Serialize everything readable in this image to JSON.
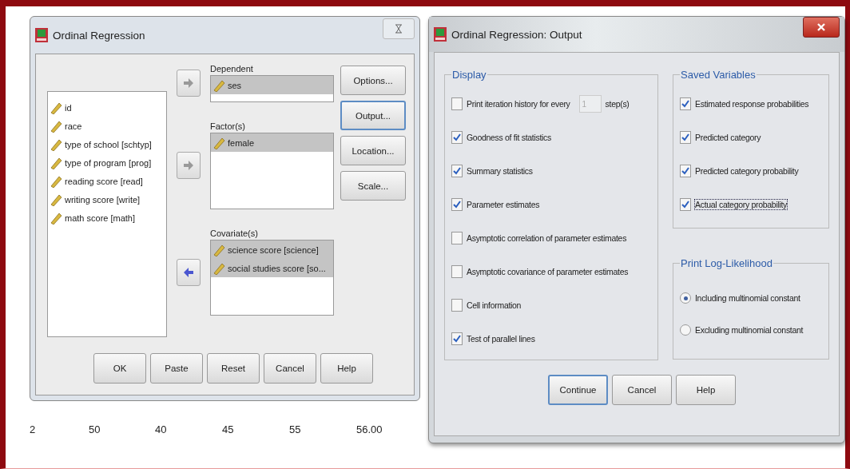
{
  "main_dialog": {
    "title": "Ordinal Regression",
    "variables": [
      {
        "label": "id",
        "selected": false
      },
      {
        "label": "race",
        "selected": false
      },
      {
        "label": "type of school [schtyp]",
        "selected": false
      },
      {
        "label": "type of program [prog]",
        "selected": false
      },
      {
        "label": "reading score [read]",
        "selected": false
      },
      {
        "label": "writing score [write]",
        "selected": false
      },
      {
        "label": "math score [math]",
        "selected": false
      }
    ],
    "targets": [
      {
        "label": "Dependent",
        "arrow": {
          "kind": "right",
          "disabled": true
        },
        "items": [
          {
            "label": "ses",
            "selected": true
          }
        ]
      },
      {
        "label": "Factor(s)",
        "arrow": {
          "kind": "right",
          "disabled": true
        },
        "items": [
          {
            "label": "female",
            "selected": true
          }
        ]
      },
      {
        "label": "Covariate(s)",
        "arrow": {
          "kind": "left",
          "disabled": false
        },
        "items": [
          {
            "label": "science score [science]",
            "selected": true
          },
          {
            "label": "social studies score [so...",
            "selected": true
          }
        ]
      }
    ],
    "side_buttons": [
      {
        "label": "Options...",
        "focused": false
      },
      {
        "label": "Output...",
        "focused": true
      },
      {
        "label": "Location...",
        "focused": false
      },
      {
        "label": "Scale...",
        "focused": false
      }
    ],
    "buttons": [
      "OK",
      "Paste",
      "Reset",
      "Cancel",
      "Help"
    ]
  },
  "data_row": [
    "2",
    "50",
    "40",
    "45",
    "55",
    "56.00"
  ],
  "output_dialog": {
    "title": "Ordinal Regression: Output",
    "display": {
      "title": "Display",
      "iteration": {
        "label": "Print iteration history for every",
        "checked": false,
        "value": "1",
        "disabled": true,
        "unit": "step(s)"
      },
      "options": [
        {
          "label": "Goodness of fit statistics",
          "checked": true
        },
        {
          "label": "Summary statistics",
          "checked": true
        },
        {
          "label": "Parameter estimates",
          "checked": true
        },
        {
          "label": "Asymptotic correlation of parameter estimates",
          "checked": false
        },
        {
          "label": "Asymptotic covariance of parameter estimates",
          "checked": false
        },
        {
          "label": "Cell information",
          "checked": false
        },
        {
          "label": "Test of parallel lines",
          "checked": true
        }
      ]
    },
    "saved_variables": {
      "title": "Saved Variables",
      "options": [
        {
          "label": "Estimated response probabilities",
          "checked": true,
          "focused": false
        },
        {
          "label": "Predicted category",
          "checked": true,
          "focused": false
        },
        {
          "label": "Predicted category probability",
          "checked": true,
          "focused": false
        },
        {
          "label": "Actual category probability",
          "checked": true,
          "focused": true
        }
      ]
    },
    "log_likelihood": {
      "title": "Print Log-Likelihood",
      "options": [
        {
          "label": "Including multinomial constant",
          "selected": true
        },
        {
          "label": "Excluding multinomial constant",
          "selected": false
        }
      ]
    },
    "buttons": [
      {
        "label": "Continue",
        "focused": true
      },
      {
        "label": "Cancel",
        "focused": false
      },
      {
        "label": "Help",
        "focused": false
      }
    ]
  }
}
